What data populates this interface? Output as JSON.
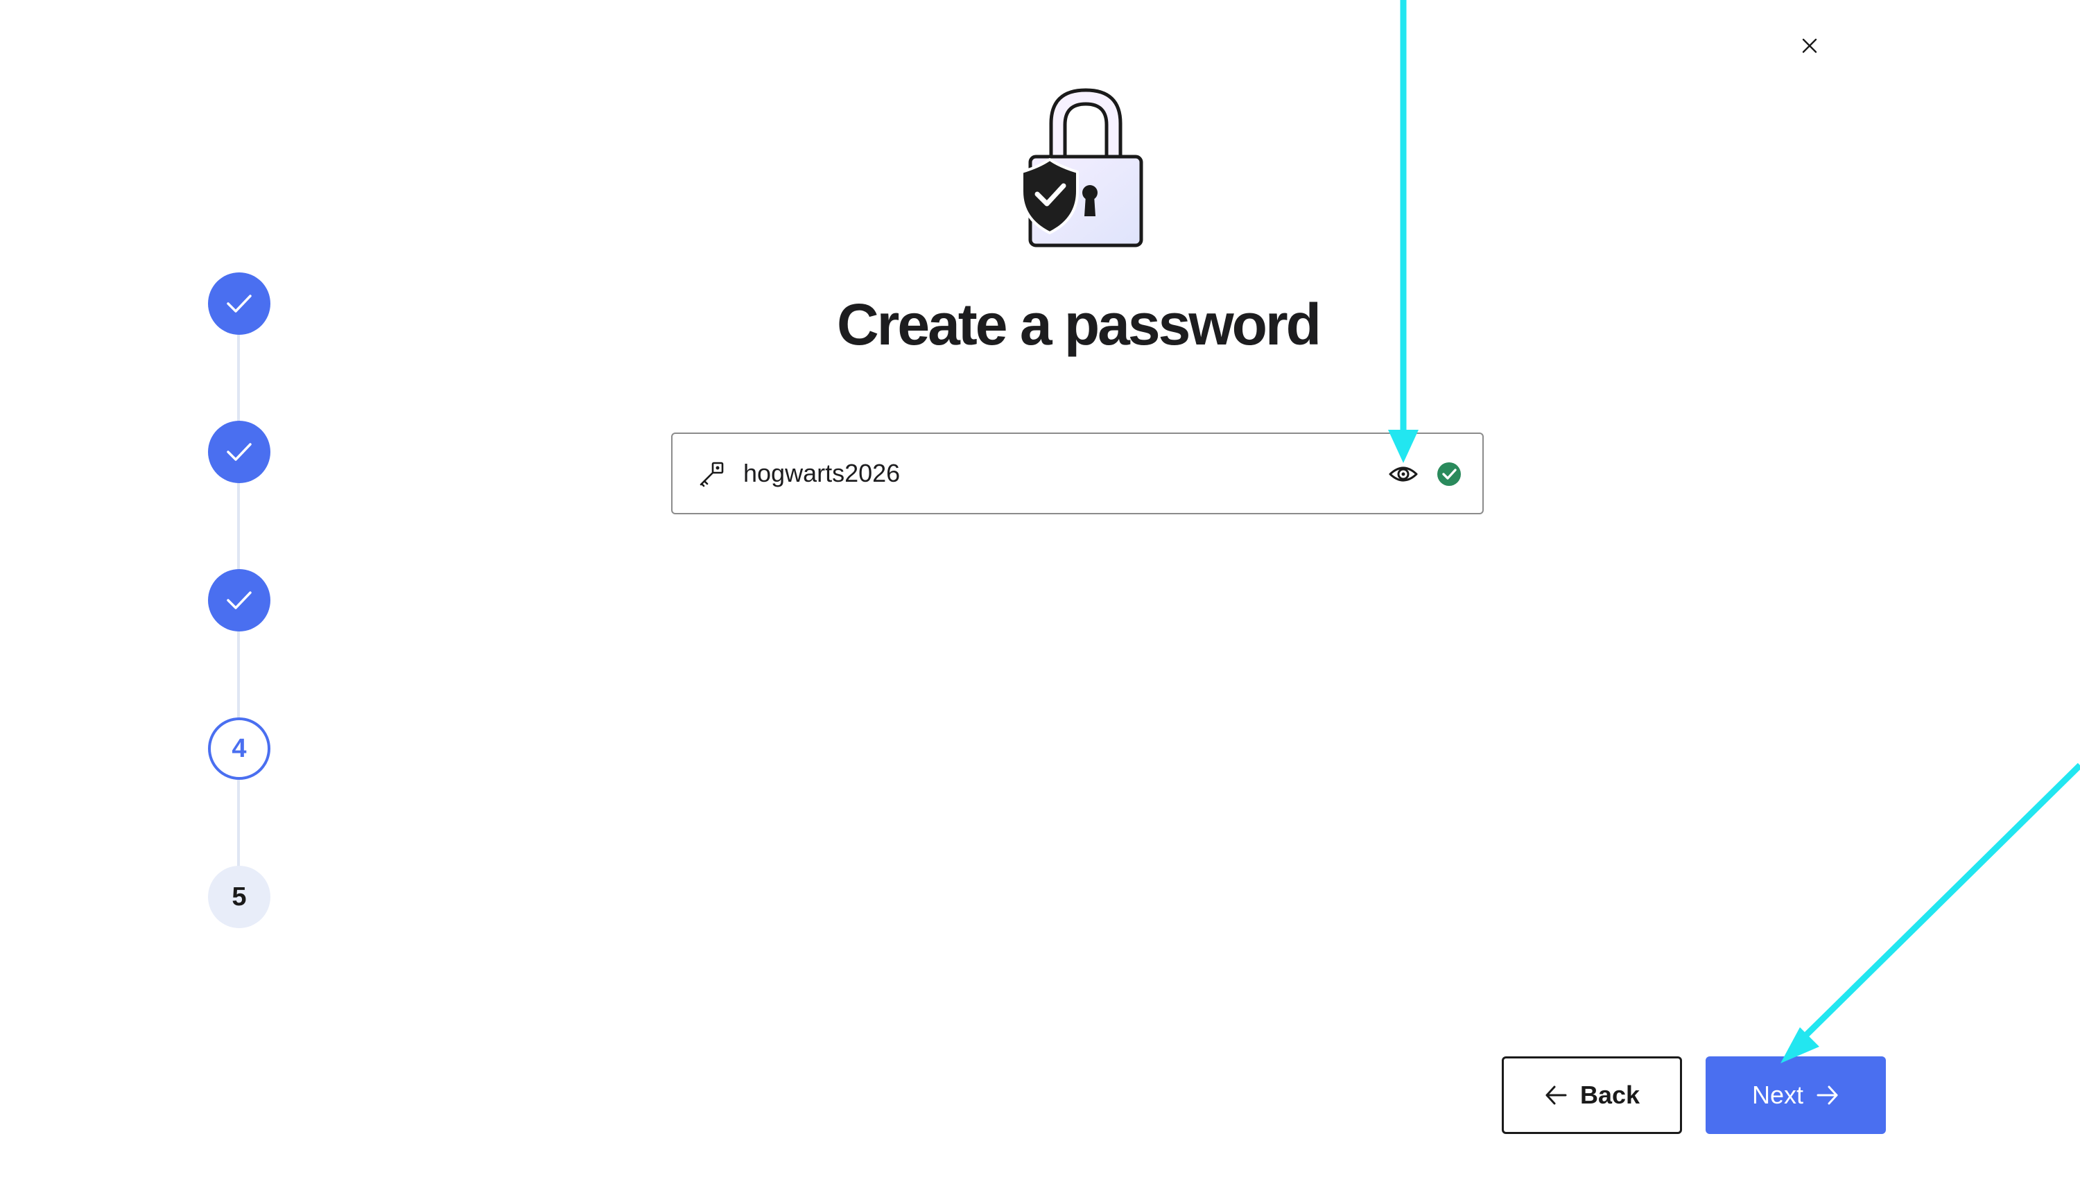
{
  "dialog": {
    "close_icon": "close-icon"
  },
  "stepper": {
    "steps": [
      {
        "state": "completed",
        "icon": "check-icon"
      },
      {
        "state": "completed",
        "icon": "check-icon"
      },
      {
        "state": "completed",
        "icon": "check-icon"
      },
      {
        "state": "current",
        "label": "4"
      },
      {
        "state": "upcoming",
        "label": "5"
      }
    ]
  },
  "illustration": {
    "icon": "padlock-shield-icon"
  },
  "page": {
    "title": "Create a password"
  },
  "password_field": {
    "value": "hogwarts2026",
    "leading_icon": "key-icon",
    "toggle_icon": "eye-icon",
    "status_icon": "check-circle-icon"
  },
  "footer": {
    "back_label": "Back",
    "next_label": "Next",
    "back_icon": "arrow-left-icon",
    "next_icon": "arrow-right-icon"
  },
  "colors": {
    "accent": "#4a6ff0",
    "success": "#2a8a5c",
    "annotation": "#22e6f0",
    "step_todo_bg": "#e8edf9"
  }
}
